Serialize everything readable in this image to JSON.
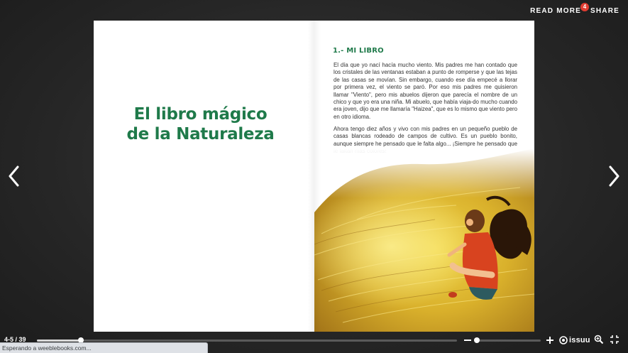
{
  "toolbar": {
    "read_more_label": "READ MORE",
    "read_more_badge": "4",
    "share_label": "SHARE"
  },
  "navigation": {
    "prev_icon": "chevron-left-icon",
    "next_icon": "chevron-right-icon"
  },
  "book": {
    "title_line1": "El libro mágico",
    "title_line2": "de la Naturaleza",
    "chapter_title": "1.- MI LIBRO",
    "paragraph1": "El día que yo nací hacía mucho viento. Mis padres me han contado que los cristales de las ventanas estaban a punto de romperse y que las tejas de las casas se movían. Sin embargo, cuando ese día empecé a llorar por primera vez, el viento se paró. Por eso mis padres me quisieron llamar \"Viento\", pero mis abuelos dijeron que parecía el nombre de un chico y que yo era una niña. Mi abuelo, que había viaja-do mucho cuando era joven, dijo que me llamaría \"Haizea\", que es lo mismo que viento pero en otro idioma.",
    "paragraph2": "Ahora tengo diez años y vivo con mis padres en un pequeño pueblo de casas blancas rodeado de campos de cultivo. Es un pueblo bonito, aunque siempre he pensado que le falta algo... ¡Siempre he pensado que le faltan más colores!",
    "accent_color": "#1f7a4a"
  },
  "footer": {
    "page_indicator": "4-5 / 39",
    "progress_fraction": 0.105,
    "zoom_fraction": 0.02,
    "brand_label": "issuu",
    "icons": [
      "minus-icon",
      "plus-icon",
      "issuu-logo-icon",
      "zoom-search-icon",
      "fullscreen-exit-icon"
    ]
  },
  "browser_status": {
    "text": "Esperando a weeblebooks.com..."
  }
}
